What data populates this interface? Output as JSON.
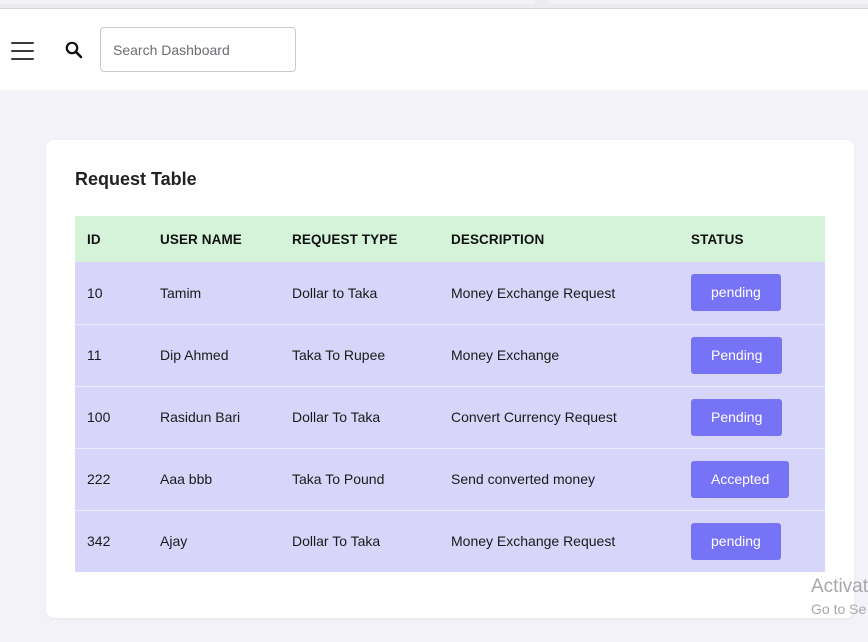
{
  "header": {
    "menu_icon": "hamburger-menu-icon",
    "search_icon": "search-icon",
    "search_placeholder": "Search Dashboard",
    "search_value": ""
  },
  "card": {
    "title": "Request Table",
    "columns": [
      "ID",
      "USER NAME",
      "REQUEST TYPE",
      "DESCRIPTION",
      "STATUS"
    ],
    "rows": [
      {
        "id": "10",
        "user": "Tamim",
        "type": "Dollar to Taka",
        "description": "Money Exchange Request",
        "status": "pending"
      },
      {
        "id": "11",
        "user": "Dip Ahmed",
        "type": "Taka To Rupee",
        "description": "Money Exchange",
        "status": "Pending"
      },
      {
        "id": "100",
        "user": "Rasidun Bari",
        "type": "Dollar To Taka",
        "description": "Convert Currency Request",
        "status": "Pending"
      },
      {
        "id": "222",
        "user": "Aaa bbb",
        "type": "Taka To Pound",
        "description": "Send converted money",
        "status": "Accepted"
      },
      {
        "id": "342",
        "user": "Ajay",
        "type": "Dollar To Taka",
        "description": "Money Exchange Request",
        "status": "pending"
      }
    ]
  },
  "watermark": {
    "line1": "Activat",
    "line2": "Go to Se"
  },
  "colors": {
    "page_bg": "#f3f2f8",
    "header_row_bg": "#d5f3d8",
    "body_row_bg": "#d7d6fa",
    "status_button": "#7773f7"
  }
}
